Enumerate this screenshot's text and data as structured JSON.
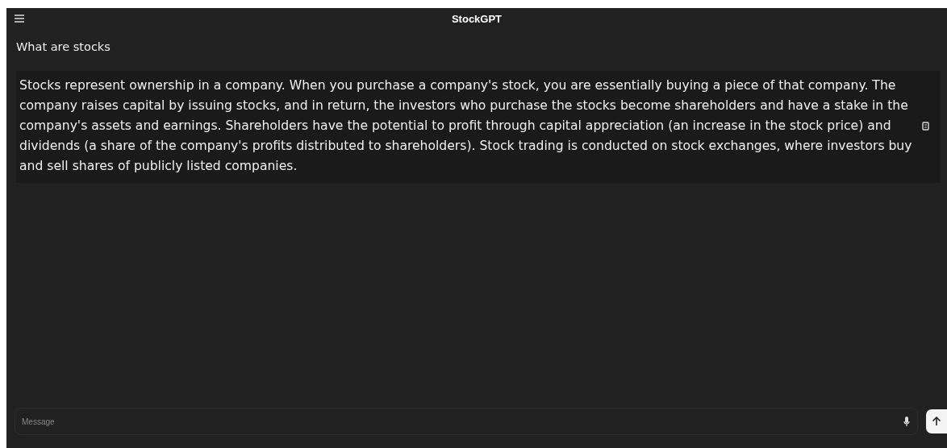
{
  "app_bar": {
    "title": "StockGPT"
  },
  "messages": [
    {
      "kind": "question",
      "text": "What are stocks"
    },
    {
      "kind": "answer",
      "text": "Stocks represent ownership in a company. When you purchase a company's stock, you are essentially buying a piece of that company. The company raises capital by issuing stocks, and in return, the investors who purchase the stocks become shareholders and have a stake in the company's assets and earnings. Shareholders have the potential to profit through capital appreciation (an increase in the stock price) and dividends (a share of the company's profits distributed to shareholders). Stock trading is conducted on stock exchanges, where investors buy and sell shares of publicly listed companies."
    }
  ],
  "composer": {
    "placeholder": "Message"
  }
}
